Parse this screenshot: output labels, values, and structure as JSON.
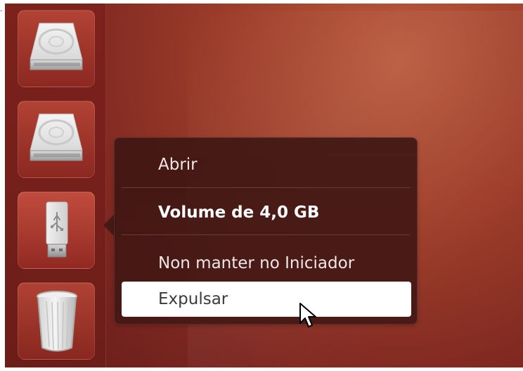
{
  "context_menu": {
    "items": [
      {
        "label": "Abrir",
        "style": "normal"
      },
      {
        "label": "Volume de 4,0 GB",
        "style": "bold"
      },
      {
        "label": "Non manter no Iniciador",
        "style": "normal"
      },
      {
        "label": "Expulsar",
        "style": "highlighted"
      }
    ]
  },
  "launcher": {
    "items": [
      {
        "icon": "hard-drive-icon"
      },
      {
        "icon": "hard-drive-icon"
      },
      {
        "icon": "usb-drive-icon"
      },
      {
        "icon": "trash-icon"
      }
    ]
  },
  "colors": {
    "desktop_background": "#9d3d2a",
    "launcher_background": "#7d211c",
    "menu_background": "#3d1613",
    "highlight_background": "#ffffff",
    "menu_text": "#efe7e5",
    "highlight_text": "#3b3b3b"
  }
}
